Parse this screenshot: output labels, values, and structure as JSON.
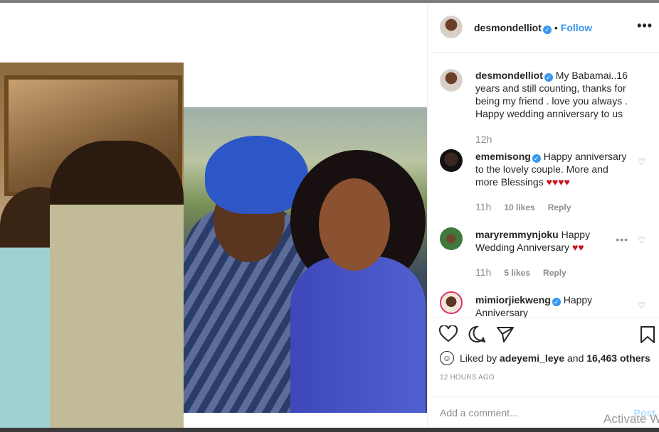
{
  "header": {
    "username": "desmondelliot",
    "follow_label": "Follow",
    "separator": "•",
    "more_label": "•••"
  },
  "caption": {
    "username": "desmondelliot",
    "text": "My Babamai..16 years and still counting, thanks for being my friend . love you always . Happy wedding anniversary to us",
    "time": "12h"
  },
  "comments": [
    {
      "username": "ememisong",
      "text": "Happy anniversary to the lovely couple. More and more Blessings",
      "hearts": "♥♥♥♥",
      "time": "11h",
      "likes": "10 likes",
      "reply": "Reply"
    },
    {
      "username": "maryremmynjoku",
      "text": "Happy Wedding Anniversary",
      "hearts": "♥♥",
      "time": "11h",
      "likes": "5 likes",
      "reply": "Reply"
    },
    {
      "username": "mimiorjiekweng",
      "text": "Happy Anniversary"
    }
  ],
  "likes": {
    "prefix": "Liked by",
    "user": "adeyemi_leye",
    "mid": "and",
    "count": "16,463 others"
  },
  "post_time": "12 HOURS AGO",
  "add_comment": {
    "placeholder": "Add a comment...",
    "post_label": "Post"
  },
  "watermark": "Activate W",
  "colors": {
    "accent": "#3897f0",
    "heart": "#c4161c"
  }
}
